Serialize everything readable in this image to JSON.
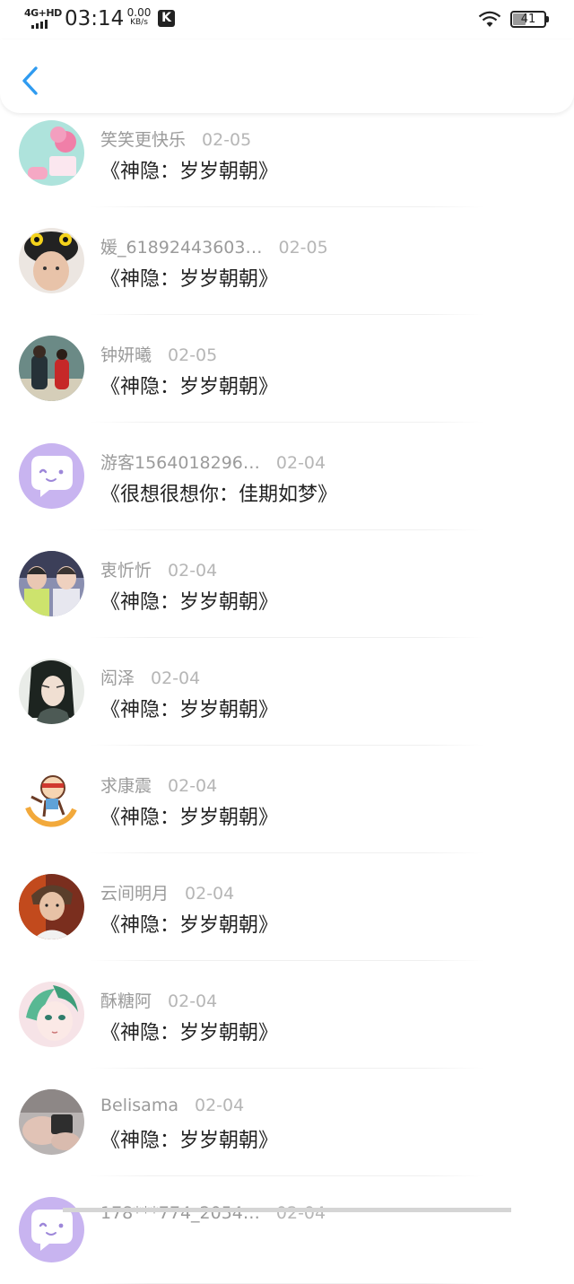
{
  "status_bar": {
    "network": "4G+HD",
    "time": "03:14",
    "speed_value": "0.00",
    "speed_unit": "KB/s",
    "app_badge": "K",
    "battery": "41",
    "battery_level_percent": 41
  },
  "nav": {
    "back_icon": "chevron-left-icon",
    "accent_color": "#2f9bf0"
  },
  "comments": [
    {
      "user": "笑笑更快乐",
      "date": "02-05",
      "book": "《神隐：岁岁朝朝》",
      "avatar": "avatar-pink-dessert"
    },
    {
      "user": "媛_61892443603…",
      "date": "02-05",
      "book": "《神隐：岁岁朝朝》",
      "avatar": "avatar-child-monster-hat"
    },
    {
      "user": "钟妍曦",
      "date": "02-05",
      "book": "《神隐：岁岁朝朝》",
      "avatar": "avatar-couple-photo"
    },
    {
      "user": "游客1564018296…",
      "date": "02-04",
      "book": "《很想很想你：佳期如梦》",
      "avatar": "avatar-default-chat"
    },
    {
      "user": "衷忻忻",
      "date": "02-04",
      "book": "《神隐：岁岁朝朝》",
      "avatar": "avatar-two-boys"
    },
    {
      "user": "闳泽",
      "date": "02-04",
      "book": "《神隐：岁岁朝朝》",
      "avatar": "avatar-costume-character"
    },
    {
      "user": "求康震",
      "date": "02-04",
      "book": "《神隐：岁岁朝朝》",
      "avatar": "avatar-cartoon-runner"
    },
    {
      "user": "云间明月",
      "date": "02-04",
      "book": "《神隐：岁岁朝朝》",
      "avatar": "avatar-young-man"
    },
    {
      "user": "酥糖阿",
      "date": "02-04",
      "book": "《神隐：岁岁朝朝》",
      "avatar": "avatar-anime-girl"
    },
    {
      "user": "Belisama",
      "date": "02-04",
      "book": "《神隐：岁岁朝朝》",
      "avatar": "avatar-hands-photo"
    },
    {
      "user": "178***774_2054…",
      "date": "02-04",
      "book": "",
      "avatar": "avatar-default-chat"
    }
  ]
}
